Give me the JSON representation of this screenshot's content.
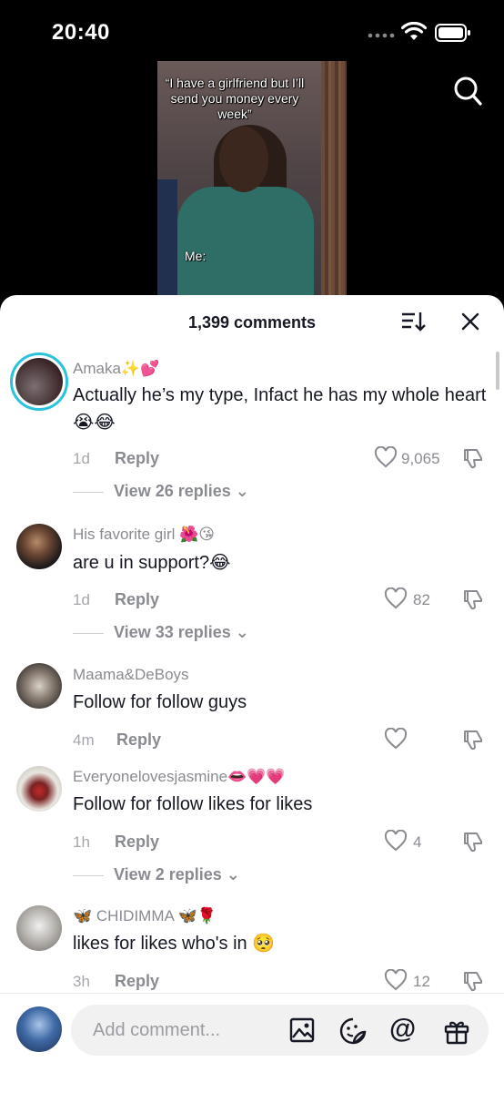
{
  "status_bar": {
    "time": "20:40"
  },
  "video": {
    "caption": "“I have a girlfriend but I’ll send you money every week”",
    "label": "Me:"
  },
  "comments_panel": {
    "count_label": "1,399 comments",
    "comments": [
      {
        "username": "Amaka✨💕",
        "text": "Actually he’s my type, Infact he has my whole heart😭😂",
        "time": "1d",
        "reply": "Reply",
        "likes": "9,065",
        "view_replies": "View 26 replies"
      },
      {
        "username": "His favorite girl 🌺😘",
        "text": "are u in support?😂",
        "time": "1d",
        "reply": "Reply",
        "likes": "82",
        "view_replies": "View 33 replies"
      },
      {
        "username": "Maama&DeBoys",
        "text": "Follow for follow guys",
        "time": "4m",
        "reply": "Reply",
        "likes": ""
      },
      {
        "username": "Everyonelovesjasmine👄💗💗",
        "text": "Follow for follow likes for likes",
        "time": "1h",
        "reply": "Reply",
        "likes": "4",
        "view_replies": "View 2 replies"
      },
      {
        "username": "🦋 CHIDIMMA 🦋🌹",
        "text": "likes for likes who's in 🥺",
        "time": "3h",
        "reply": "Reply",
        "likes": "12"
      }
    ]
  },
  "composer": {
    "placeholder": "Add comment..."
  },
  "colors": {
    "story_ring": "#2bc3dc",
    "text_primary": "#161823",
    "text_secondary": "#8a8b91"
  },
  "icons": [
    "search-icon",
    "sort-icon",
    "close-icon",
    "heart-icon",
    "dislike-icon",
    "image-icon",
    "sticker-icon",
    "mention-icon",
    "gift-icon"
  ]
}
